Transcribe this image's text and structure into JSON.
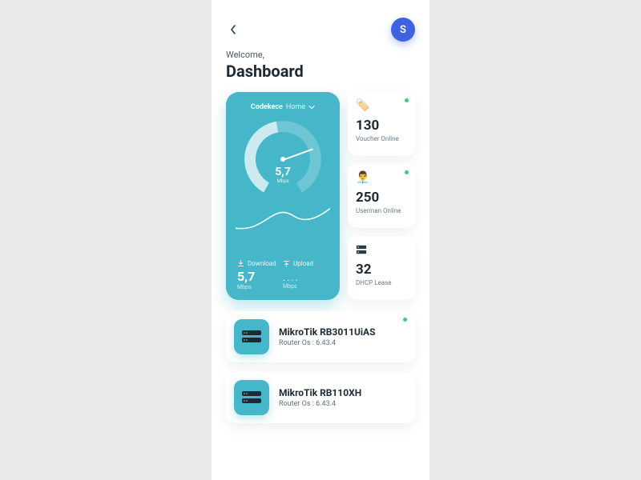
{
  "header": {
    "avatar_initial": "S",
    "welcome": "Welcome,",
    "title": "Dashboard"
  },
  "network": {
    "selected_strong": "Codekece",
    "selected_light": "Home",
    "gauge_value": "5,7",
    "gauge_unit": "Mbps",
    "download_label": "Download",
    "download_value": "5,7",
    "download_unit": "Mbps",
    "upload_label": "Upload",
    "upload_value": "....",
    "upload_unit": "Mbps"
  },
  "stats": {
    "voucher": {
      "value": "130",
      "label": "Voucher Online"
    },
    "userman": {
      "value": "250",
      "label": "Userman Online"
    },
    "dhcp": {
      "value": "32",
      "label": "DHCP Lease"
    }
  },
  "devices": [
    {
      "name": "MikroTik RB3011UiAS",
      "os": "Router Os : 6.43.4"
    },
    {
      "name": "MikroTik RB110XH",
      "os": "Router Os : 6.43.4"
    }
  ]
}
